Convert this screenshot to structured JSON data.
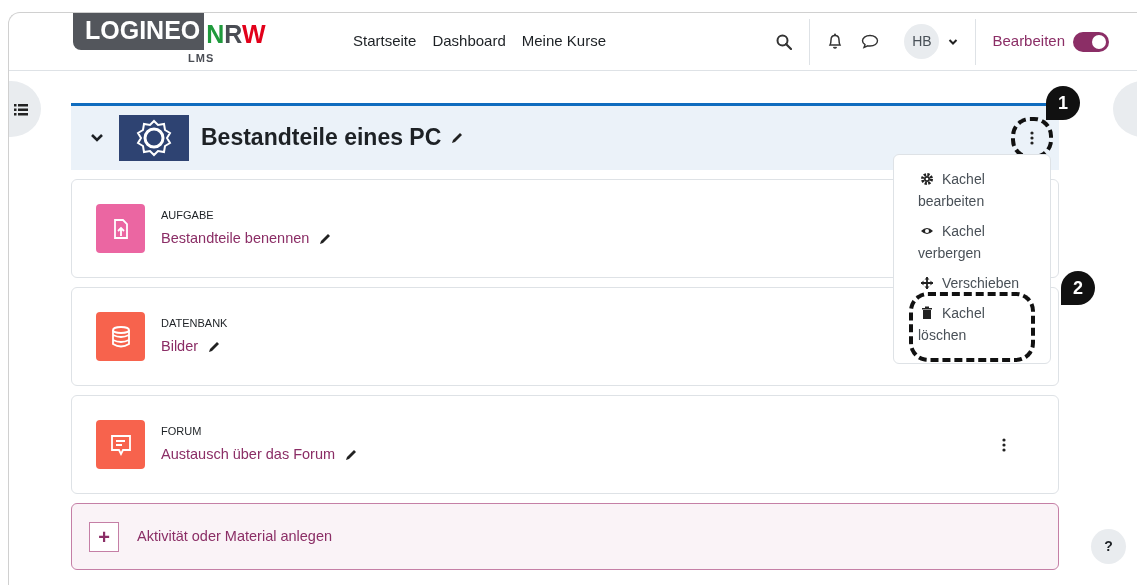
{
  "logo": {
    "main": "LOGINEO",
    "letters": [
      {
        "text": "N",
        "color": "#1f9a3c"
      },
      {
        "text": "R",
        "color": "#4a4d54"
      },
      {
        "text": "W",
        "color": "#e2001a"
      }
    ],
    "sub": "LMS"
  },
  "nav": [
    {
      "label": "Startseite"
    },
    {
      "label": "Dashboard"
    },
    {
      "label": "Meine Kurse"
    }
  ],
  "user": {
    "initials": "HB"
  },
  "edit_mode": {
    "label": "Bearbeiten",
    "on": true
  },
  "section": {
    "title": "Bestandteile eines PC",
    "expanded": true,
    "callout": "1"
  },
  "menu": [
    {
      "kind": "gear",
      "label": "Kachel bearbeiten"
    },
    {
      "kind": "eye",
      "label": "Kachel verbergen"
    },
    {
      "kind": "move",
      "label": "Verschieben"
    },
    {
      "kind": "trash",
      "label": "Kachel löschen",
      "callout": "2"
    }
  ],
  "activities": [
    {
      "kind": "assign",
      "type": "AUFGABE",
      "name": "Bestandteile benennen",
      "color": "#eb66a2",
      "menu_visible": false
    },
    {
      "kind": "data",
      "type": "DATENBANK",
      "name": "Bilder",
      "color": "#f7634d",
      "menu_visible": false
    },
    {
      "kind": "forum",
      "type": "FORUM",
      "name": "Austausch über das Forum",
      "color": "#f7634d",
      "menu_visible": true
    }
  ],
  "add_activity": {
    "label": "Aktivität oder Material anlegen",
    "icon": "+"
  },
  "help": {
    "label": "?"
  }
}
